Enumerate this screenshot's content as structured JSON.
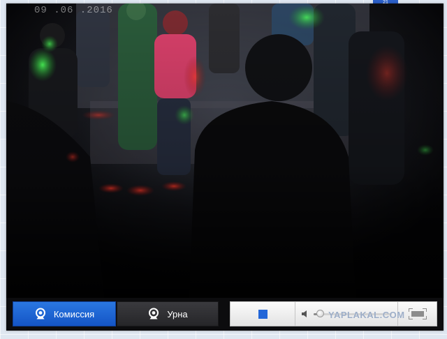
{
  "video": {
    "osd_text": "09 .06 .2016"
  },
  "controls": {
    "tabs": [
      {
        "label": "Комиссия",
        "icon": "webcam-icon",
        "active": true
      },
      {
        "label": "Урна",
        "icon": "webcam-icon",
        "active": false
      }
    ],
    "stop_icon": "stop-icon",
    "volume_icon": "speaker-icon",
    "volume_level": 0.05,
    "fullscreen_icon": "fullscreen-icon"
  },
  "edge_tag": "21",
  "watermark": {
    "text": "YAPLAKAL.COM"
  },
  "colors": {
    "accent": "#1f66d4",
    "stop": "#2266d8",
    "control_bar": "#0c0c0e",
    "panel": "#efefef"
  }
}
